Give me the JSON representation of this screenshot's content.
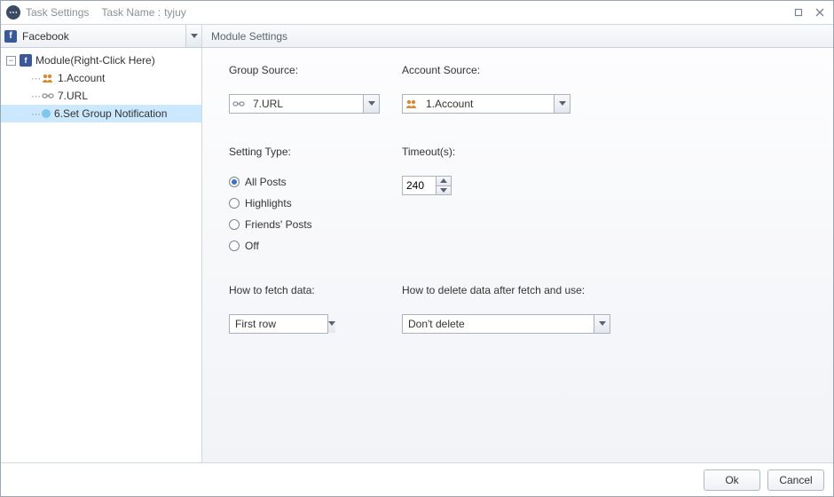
{
  "window": {
    "title_prefix": "Task Settings",
    "task_label": "Task Name :",
    "task_name": "tyjuy"
  },
  "sidebar": {
    "selector_label": "Facebook",
    "root_label": "Module(Right-Click Here)",
    "items": [
      {
        "label": "1.Account",
        "icon": "account"
      },
      {
        "label": "7.URL",
        "icon": "url"
      },
      {
        "label": "6.Set Group Notification",
        "icon": "dot",
        "selected": true
      }
    ]
  },
  "main": {
    "header": "Module Settings",
    "group_source": {
      "label": "Group Source:",
      "value": "7.URL"
    },
    "account_source": {
      "label": "Account Source:",
      "value": "1.Account"
    },
    "setting_type": {
      "label": "Setting Type:",
      "options": [
        "All Posts",
        "Highlights",
        "Friends' Posts",
        "Off"
      ],
      "selected": "All Posts"
    },
    "timeout": {
      "label": "Timeout(s):",
      "value": "240"
    },
    "fetch": {
      "label": "How to fetch data:",
      "value": "First row"
    },
    "delete_after": {
      "label": "How to delete data after fetch and use:",
      "value": "Don't delete"
    }
  },
  "footer": {
    "ok": "Ok",
    "cancel": "Cancel"
  }
}
